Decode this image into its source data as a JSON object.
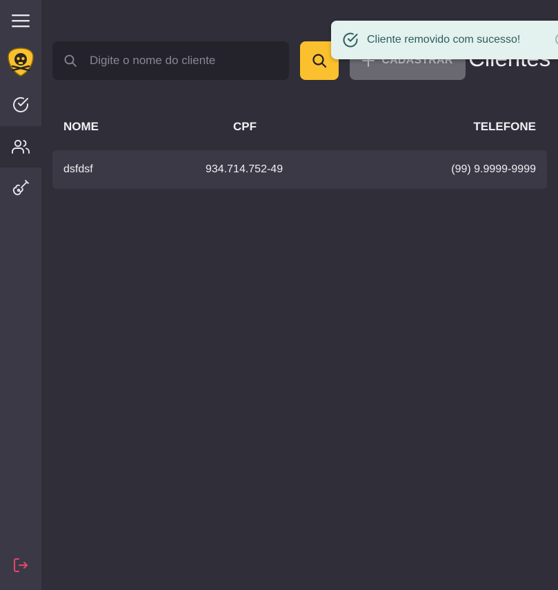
{
  "sidebar": {
    "items": [
      {
        "icon": "menu-icon"
      },
      {
        "icon": "logo-badge-icon"
      },
      {
        "icon": "check-circle-icon"
      },
      {
        "icon": "users-icon",
        "active": true
      },
      {
        "icon": "guitar-icon"
      },
      {
        "icon": "logout-icon"
      }
    ]
  },
  "header": {
    "search_placeholder": "Digite o nome do cliente",
    "search_value": "",
    "add_label": "CADASTRAR",
    "title": "Clientes"
  },
  "toast": {
    "message": "Cliente removido com sucesso!"
  },
  "table": {
    "columns": [
      "NOME",
      "CPF",
      "TELEFONE"
    ],
    "rows": [
      [
        "dsfdsf",
        "934.714.752-49",
        "(99) 9.9999-9999"
      ]
    ]
  },
  "colors": {
    "background": "#302e38",
    "sidebar": "#3c3946",
    "accent": "#fbc02d",
    "logout": "#e5476b",
    "toast_bg": "#e3f1ef",
    "toast_text": "#2d5e5a"
  }
}
